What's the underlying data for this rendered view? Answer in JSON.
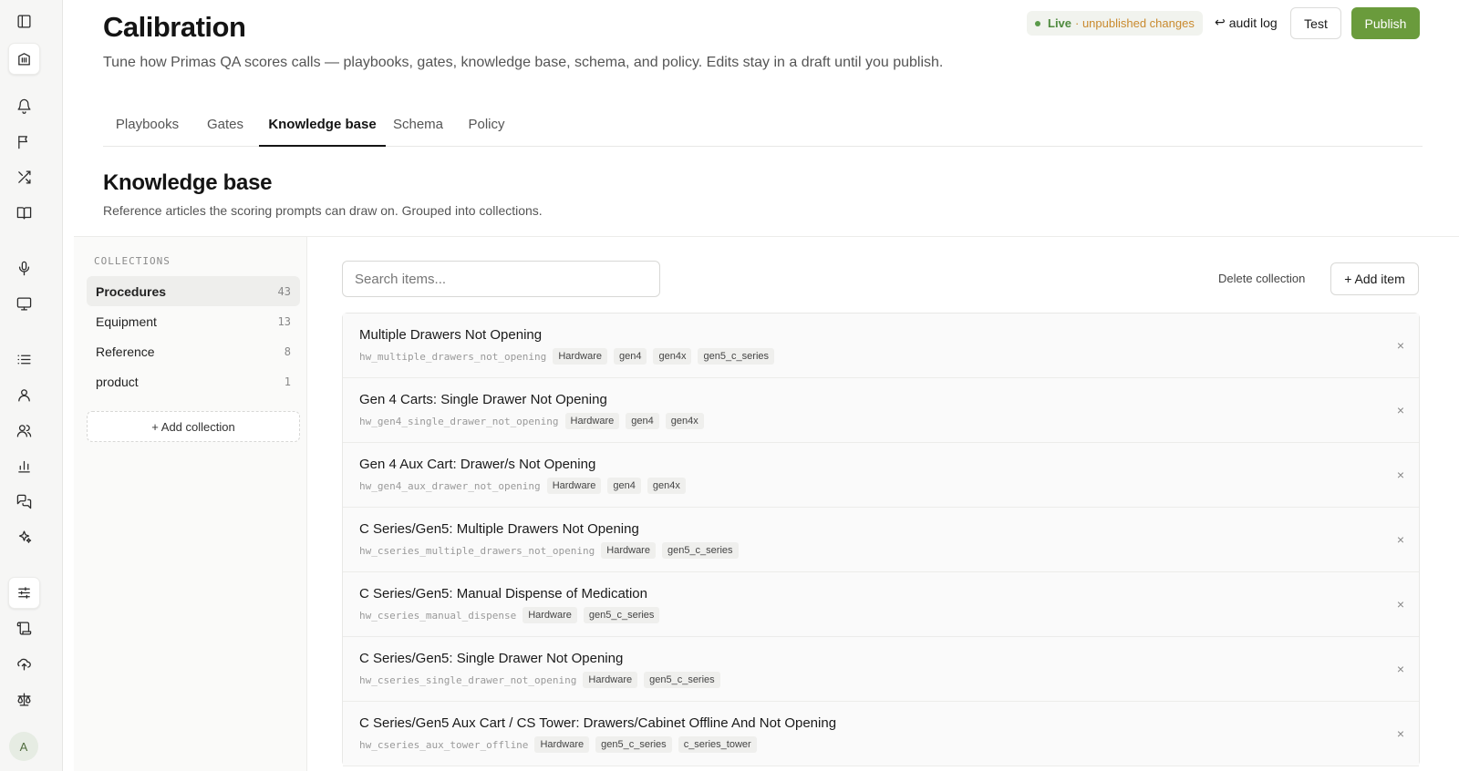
{
  "rail": {
    "icons": [
      "sidebar-toggle-icon",
      "building-icon",
      "bell-icon",
      "flag-icon",
      "shuffle-icon",
      "book-icon",
      "mic-icon",
      "monitor-icon",
      "list-icon",
      "user-icon",
      "users-icon",
      "bar-chart-icon",
      "messages-icon",
      "sparkles-icon",
      "sliders-icon",
      "scroll-icon",
      "cloud-upload-icon",
      "scale-icon"
    ],
    "avatar": "A"
  },
  "header": {
    "title": "Calibration",
    "subtitle": "Tune how Primas QA scores calls — playbooks, gates, knowledge base, schema, and policy. Edits stay in a draft until you publish.",
    "status_live": "Live",
    "status_changes": "· unpublished changes",
    "audit_log": "audit log",
    "audit_icon": "↩",
    "test_label": "Test",
    "publish_label": "Publish",
    "colors": {
      "accent": "#6a9b3c",
      "live": "#4f8a3e",
      "changes": "#c98a2e"
    }
  },
  "tabs": [
    {
      "label": "Playbooks"
    },
    {
      "label": "Gates"
    },
    {
      "label": "Knowledge base",
      "active": true
    },
    {
      "label": "Schema"
    },
    {
      "label": "Policy"
    }
  ],
  "section": {
    "title": "Knowledge base",
    "subtitle": "Reference articles the scoring prompts can draw on. Grouped into collections."
  },
  "collections": {
    "header": "COLLECTIONS",
    "items": [
      {
        "label": "Procedures",
        "count": "43",
        "active": true
      },
      {
        "label": "Equipment",
        "count": "13"
      },
      {
        "label": "Reference",
        "count": "8"
      },
      {
        "label": "product",
        "count": "1"
      }
    ],
    "add_label": "+ Add collection"
  },
  "toolbar": {
    "search_placeholder": "Search items...",
    "delete_collection": "Delete collection",
    "add_item": "+ Add item"
  },
  "items": [
    {
      "title": "Multiple Drawers Not Opening",
      "key": "hw_multiple_drawers_not_opening",
      "tags": [
        "Hardware",
        "gen4",
        "gen4x",
        "gen5_c_series"
      ]
    },
    {
      "title": "Gen 4 Carts: Single Drawer Not Opening",
      "key": "hw_gen4_single_drawer_not_opening",
      "tags": [
        "Hardware",
        "gen4",
        "gen4x"
      ]
    },
    {
      "title": "Gen 4 Aux Cart: Drawer/s Not Opening",
      "key": "hw_gen4_aux_drawer_not_opening",
      "tags": [
        "Hardware",
        "gen4",
        "gen4x"
      ]
    },
    {
      "title": "C Series/Gen5: Multiple Drawers Not Opening",
      "key": "hw_cseries_multiple_drawers_not_opening",
      "tags": [
        "Hardware",
        "gen5_c_series"
      ]
    },
    {
      "title": "C Series/Gen5: Manual Dispense of Medication",
      "key": "hw_cseries_manual_dispense",
      "tags": [
        "Hardware",
        "gen5_c_series"
      ]
    },
    {
      "title": "C Series/Gen5: Single Drawer Not Opening",
      "key": "hw_cseries_single_drawer_not_opening",
      "tags": [
        "Hardware",
        "gen5_c_series"
      ]
    },
    {
      "title": "C Series/Gen5 Aux Cart / CS Tower: Drawers/Cabinet Offline And Not Opening",
      "key": "hw_cseries_aux_tower_offline",
      "tags": [
        "Hardware",
        "gen5_c_series",
        "c_series_tower"
      ]
    }
  ],
  "item_close_glyph": "×"
}
